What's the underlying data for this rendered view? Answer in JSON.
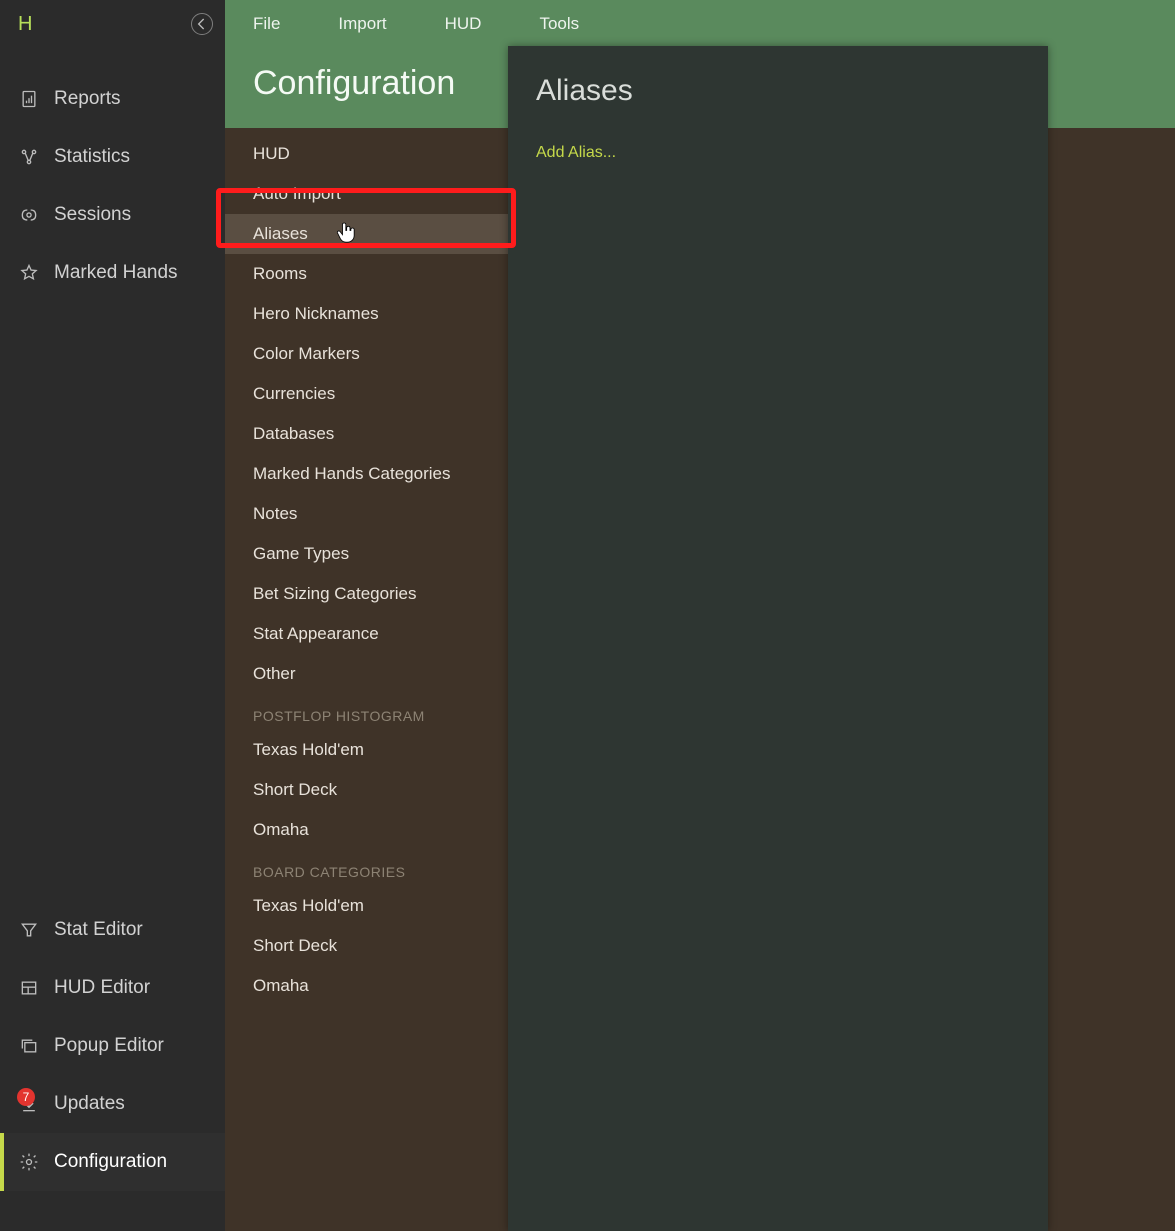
{
  "logo": "H",
  "sidebar": {
    "primary": [
      {
        "label": "Reports"
      },
      {
        "label": "Statistics"
      },
      {
        "label": "Sessions"
      },
      {
        "label": "Marked Hands"
      }
    ],
    "secondary": [
      {
        "label": "Stat Editor"
      },
      {
        "label": "HUD Editor"
      },
      {
        "label": "Popup Editor"
      },
      {
        "label": "Updates",
        "badge": "7"
      },
      {
        "label": "Configuration",
        "active": true
      }
    ]
  },
  "topmenu": [
    "File",
    "Import",
    "HUD",
    "Tools"
  ],
  "page_title": "Configuration",
  "config_list": {
    "items1": [
      "HUD",
      "Auto Import",
      "Aliases",
      "Rooms",
      "Hero Nicknames",
      "Color Markers",
      "Currencies",
      "Databases",
      "Marked Hands Categories",
      "Notes",
      "Game Types",
      "Bet Sizing Categories",
      "Stat Appearance",
      "Other"
    ],
    "header1": "POSTFLOP HISTOGRAM",
    "items2": [
      "Texas Hold'em",
      "Short Deck",
      "Omaha"
    ],
    "header2": "BOARD CATEGORIES",
    "items3": [
      "Texas Hold'em",
      "Short Deck",
      "Omaha"
    ],
    "selected": "Aliases"
  },
  "detail": {
    "title": "Aliases",
    "add_link": "Add Alias..."
  }
}
